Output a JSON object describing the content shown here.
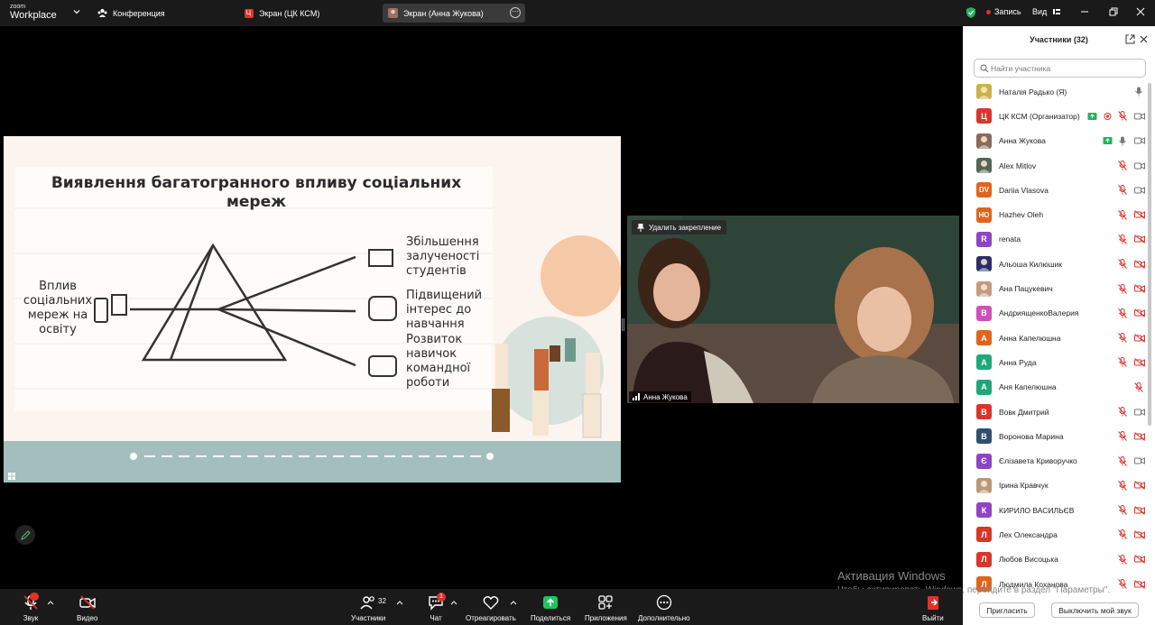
{
  "app": {
    "logo_line1": "zoom",
    "logo_line2": "Workplace"
  },
  "tabs": [
    {
      "label": "Конференция",
      "icon": "meeting-icon"
    },
    {
      "label": "Экран (ЦК КСМ)",
      "icon_letter": "Ц"
    },
    {
      "label": "Экран (Анна Жукова)",
      "icon": "avatar"
    }
  ],
  "topbar": {
    "record_label": "Запись",
    "view_label": "Вид"
  },
  "slide": {
    "title": "Виявлення багатогранного впливу соціальних мереж",
    "left_text": [
      "Вплив",
      "соціальних",
      "мереж на",
      "освіту"
    ],
    "items": [
      [
        "Збільшення",
        "залученості",
        "студентів"
      ],
      [
        "Підвищений",
        "інтерес до",
        "навчання"
      ],
      [
        "Розвиток",
        "навичок",
        "командної",
        "роботи"
      ]
    ]
  },
  "video": {
    "pin_label": "Удалить закрепление",
    "name_label": "Анна Жукова"
  },
  "participants": {
    "title": "Участники (32)",
    "search_placeholder": "Найти участника",
    "list": [
      {
        "name": "Наталія Радько (Я)",
        "avatar": "photo",
        "color": "#c9b24a",
        "mic": "on",
        "video": "none"
      },
      {
        "name": "ЦК КСМ (Организатор)",
        "letter": "Ц",
        "color": "#d9362b",
        "mic": "muted",
        "video": "on",
        "extras": [
          "screen",
          "record"
        ]
      },
      {
        "name": "Анна Жукова",
        "avatar": "photo",
        "color": "#8a6a5a",
        "mic": "on",
        "video": "on",
        "extras": [
          "screen"
        ]
      },
      {
        "name": "Alex Mitlov",
        "avatar": "photo",
        "color": "#556655",
        "mic": "muted",
        "video": "on"
      },
      {
        "name": "Dariia Vlasova",
        "letter": "DV",
        "color": "#e0641b",
        "mic": "muted",
        "video": "on"
      },
      {
        "name": "Hazhev Oleh",
        "letter": "HO",
        "color": "#e0641b",
        "mic": "muted",
        "video": "off"
      },
      {
        "name": "renata",
        "letter": "R",
        "color": "#8e44c4",
        "mic": "muted",
        "video": "off"
      },
      {
        "name": "Альоша Килюшик",
        "avatar": "photo",
        "color": "#2a2f66",
        "mic": "muted",
        "video": "off"
      },
      {
        "name": "Ана Пацукевич",
        "avatar": "photo",
        "color": "#c49a80",
        "mic": "muted",
        "video": "off"
      },
      {
        "name": "АндриященкоВалерия",
        "letter": "В",
        "color": "#d14fb8",
        "mic": "muted",
        "video": "off"
      },
      {
        "name": "Анна Капелюшна",
        "letter": "А",
        "color": "#e0641b",
        "mic": "muted",
        "video": "off"
      },
      {
        "name": "Анна Руда",
        "letter": "А",
        "color": "#1fa87a",
        "mic": "muted",
        "video": "off"
      },
      {
        "name": "Аня Капелюшна",
        "letter": "А",
        "color": "#1fa87a",
        "mic": "muted",
        "video": "none"
      },
      {
        "name": "Вовк Дмитрий",
        "letter": "В",
        "color": "#d9362b",
        "mic": "muted",
        "video": "on"
      },
      {
        "name": "Воронова Марина",
        "letter": "В",
        "color": "#2f4f6f",
        "mic": "muted",
        "video": "off"
      },
      {
        "name": "Єлізавета Криворучко",
        "letter": "Є",
        "color": "#8e44c4",
        "mic": "muted",
        "video": "on"
      },
      {
        "name": "Ірина Кравчук",
        "avatar": "photo",
        "color": "#b89878",
        "mic": "muted",
        "video": "off"
      },
      {
        "name": "КИРИЛО ВАСИЛЬЄВ",
        "letter": "К",
        "color": "#8e44c4",
        "mic": "muted",
        "video": "off"
      },
      {
        "name": "Лех Олександра",
        "letter": "Л",
        "color": "#d9362b",
        "mic": "muted",
        "video": "off"
      },
      {
        "name": "Любов Висоцька",
        "letter": "Л",
        "color": "#d9362b",
        "mic": "muted",
        "video": "off"
      },
      {
        "name": "Людмила Коханова",
        "letter": "Л",
        "color": "#e0641b",
        "mic": "muted",
        "video": "off"
      }
    ],
    "invite_label": "Пригласить",
    "mute_all_label": "Выключить мой звук"
  },
  "toolbar": {
    "audio": "Звук",
    "video": "Видео",
    "participants": "Участники",
    "participants_count": "32",
    "chat": "Чат",
    "chat_badge": "1",
    "react": "Отреагировать",
    "share": "Поделиться",
    "apps": "Приложения",
    "more": "Дополнительно",
    "leave": "Выйти"
  },
  "watermark": {
    "line1": "Активация Windows",
    "line2": "Чтобы активировать Windows, перейдите в раздел \"Параметры\"."
  }
}
